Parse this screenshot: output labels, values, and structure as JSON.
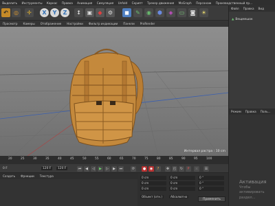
{
  "menubar": {
    "items": [
      "Выделить",
      "Инструменты",
      "Каркас",
      "Правка",
      "Анимация",
      "Симуляция",
      "Unfold",
      "Скрипт",
      "Трекер движения",
      "MoGraph",
      "Персонаж",
      "Производственный пр..."
    ]
  },
  "toolbar": {
    "xyz": [
      "X",
      "Y",
      "Z"
    ],
    "icons": [
      "undo-icon",
      "redo-icon",
      "move-icon",
      "scale-icon",
      "rotate-icon",
      "cube-icon",
      "pen-icon",
      "light-icon",
      "camera-icon"
    ]
  },
  "viewport_tabs": [
    "Просмотр",
    "Камеры",
    "Отображение",
    "Настройки",
    "Фильтр индикации",
    "Панели",
    "ProRender"
  ],
  "viewport": {
    "grid_info": "Интервал растра : 10 cm"
  },
  "right_panel": {
    "menu": [
      "Файл",
      "Правка",
      "Вид"
    ],
    "object_item": "Вещмешок",
    "attr_menu": [
      "Режим",
      "Правка",
      "Поль..."
    ]
  },
  "timeline": {
    "ticks": [
      "20",
      "25",
      "30",
      "35",
      "40",
      "45",
      "50",
      "55",
      "60",
      "65",
      "70",
      "75",
      "80",
      "85",
      "90",
      "95",
      "100"
    ],
    "frame_start": "0 F",
    "frame_current": "120 F",
    "frame_end": "120 F"
  },
  "bottom": {
    "tabs": [
      "Создать",
      "Функции",
      "Текстура"
    ],
    "coords": {
      "rows": [
        [
          "0 cm",
          "0 cm",
          "0 °"
        ],
        [
          "0 cm",
          "0 cm",
          "0 °"
        ],
        [
          "0 cm",
          "0 cm",
          "0 °"
        ]
      ],
      "mode_left": "Объект (отн.)",
      "mode_right": "Абсолютно",
      "apply_label": "Применить"
    }
  },
  "watermark": {
    "line1": "Активация",
    "line2": "Чтобы активировать",
    "line3": "раздел..."
  },
  "colors": {
    "accent_orange": "#e09a2e",
    "xyz_blue": "#2f6fb5"
  }
}
